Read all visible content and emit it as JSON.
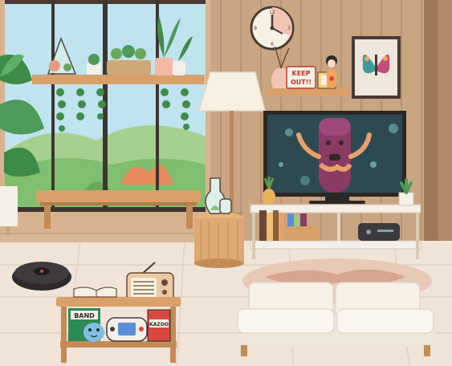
{
  "scene": {
    "sign_text": [
      "KEEP",
      "OUT!!"
    ],
    "game_box_text": "KAZOO",
    "book_text": "BAND",
    "clock_numerals": [
      "12",
      "3",
      "6",
      "9"
    ]
  },
  "palette": {
    "wall": "#c9a582",
    "wall_stripe": "#b99371",
    "floor": "#efe4d7",
    "sky": "#bfe3ef",
    "tv_screen": "#2d4a52",
    "character": "#8b3a64",
    "sofa": "#f6f0e6",
    "rug": "#e8c9b6",
    "accent_red": "#d8473e"
  }
}
